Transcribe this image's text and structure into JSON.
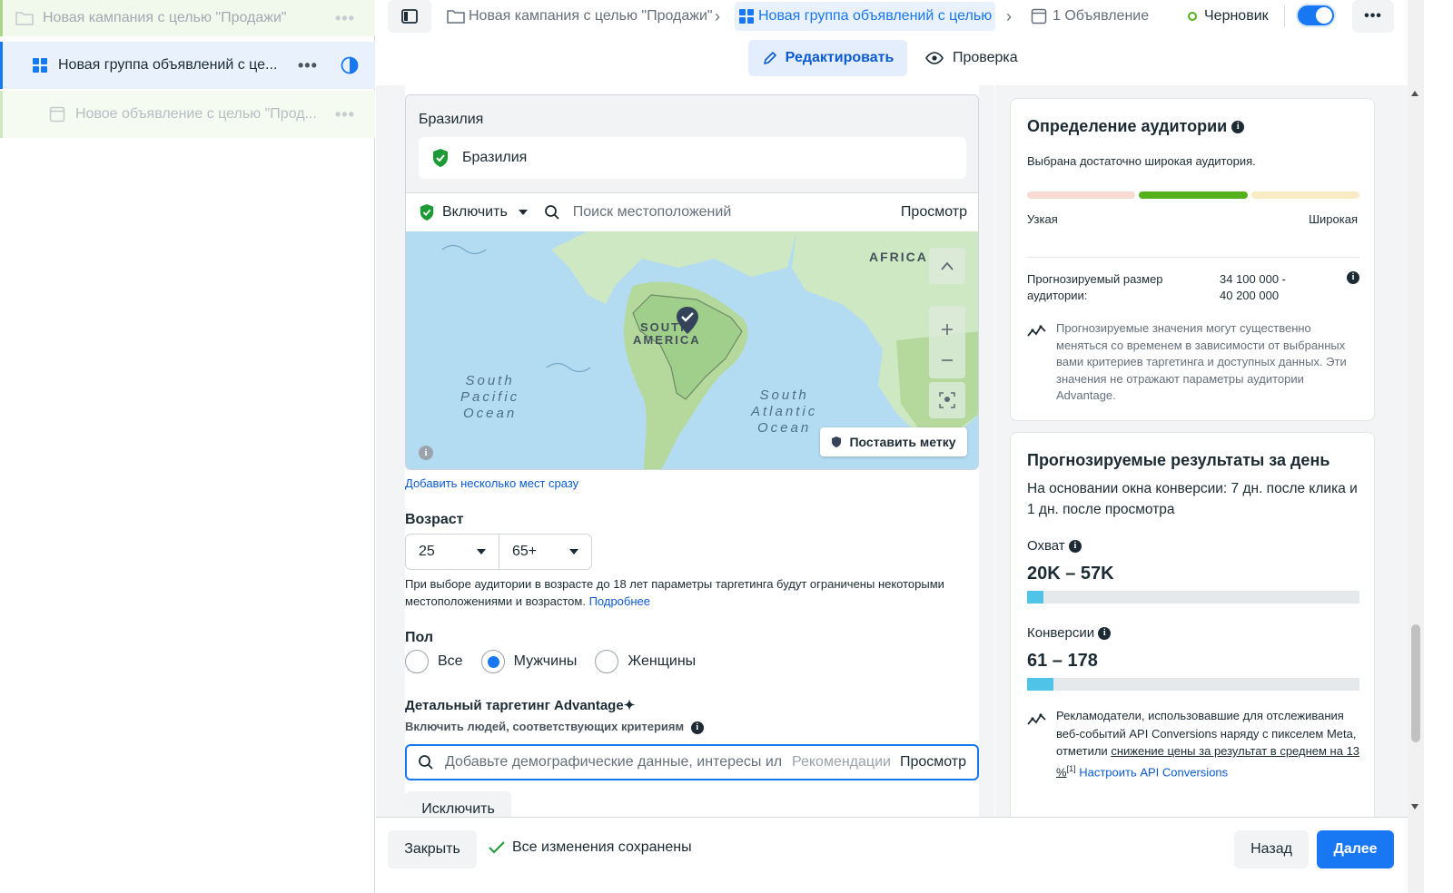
{
  "sidebar": {
    "campaign": {
      "label": "Новая кампания с целью \"Продажи\""
    },
    "adset": {
      "label": "Новая группа объявлений с це..."
    },
    "ad": {
      "label": "Новое объявление с целью \"Прод..."
    },
    "more_label": "•••"
  },
  "topbar": {
    "crumb_campaign": "Новая кампания с целью \"Продажи\"",
    "crumb_adset": "Новая группа объявлений с целью",
    "crumb_ad": "1 Объявление",
    "status": "Черновик",
    "separator": "›",
    "more_label": "•••"
  },
  "mode": {
    "edit": "Редактировать",
    "review": "Проверка"
  },
  "location": {
    "header": "Бразилия",
    "selected": "Бразилия",
    "include": "Включить",
    "search_placeholder": "Поиск местоположений",
    "browse": "Просмотр",
    "map_labels": {
      "africa": "AFRICA",
      "south_america_1": "SOUTH",
      "south_america_2": "AMERICA",
      "pacific": [
        "South",
        "Pacific",
        "Ocean"
      ],
      "atlantic": [
        "South",
        "Atlantic",
        "Ocean"
      ]
    },
    "drop_pin": "Поставить метку",
    "add_multiple": "Добавить несколько мест сразу"
  },
  "age": {
    "label": "Возраст",
    "min": "25",
    "max": "65+",
    "note": "При выборе аудитории в возрасте до 18 лет параметры таргетинга будут ограничены некоторыми местоположениями и возрастом.",
    "learn_more": "Подробнее"
  },
  "gender": {
    "label": "Пол",
    "options": [
      "Все",
      "Мужчины",
      "Женщины"
    ],
    "selected": "Мужчины"
  },
  "targeting": {
    "title": "Детальный таргетинг Advantage",
    "sparkle": "✦",
    "subtitle": "Включить людей, соответствующих критериям",
    "placeholder": "Добавьте демографические данные, интересы ил",
    "suggestions": "Рекомендации",
    "browse": "Просмотр",
    "exclude": "Исключить"
  },
  "audience": {
    "title": "Определение аудитории",
    "status": "Выбрана достаточно широкая аудитория.",
    "narrow": "Узкая",
    "broad": "Широкая",
    "size_label": "Прогнозируемый размер аудитории:",
    "size_value_1": "34 100 000 -",
    "size_value_2": "40 200 000",
    "disclaimer": "Прогнозируемые значения могут существенно меняться со временем в зависимости от выбранных вами критериев таргетинга и доступных данных. Эти значения не отражают параметры аудитории Advantage."
  },
  "daily": {
    "title": "Прогнозируемые результаты за день",
    "basis": "На основании окна конверсии: 7 дн. после клика и 1 дн. после просмотра",
    "reach_label": "Охват",
    "reach_value": "20K – 57K",
    "reach_fill": 0.05,
    "conv_label": "Конверсии",
    "conv_value": "61 – 178",
    "conv_fill": 0.08,
    "tip_1": "Рекламодатели, использовавшие для отслеживания веб-событий API Conversions наряду с пикселем Meta, отметили",
    "tip_link": "снижение цены за результат в среднем на 13 %",
    "tip_ref": "[1]",
    "tip_action": "Настроить API Conversions"
  },
  "footer": {
    "close": "Закрыть",
    "saved": "Все изменения сохранены",
    "back": "Назад",
    "next": "Далее"
  },
  "colors": {
    "accent": "#1877f2",
    "success": "#1d9a36",
    "reach": "#4fc3e8",
    "audience_good": "#54b11c"
  }
}
